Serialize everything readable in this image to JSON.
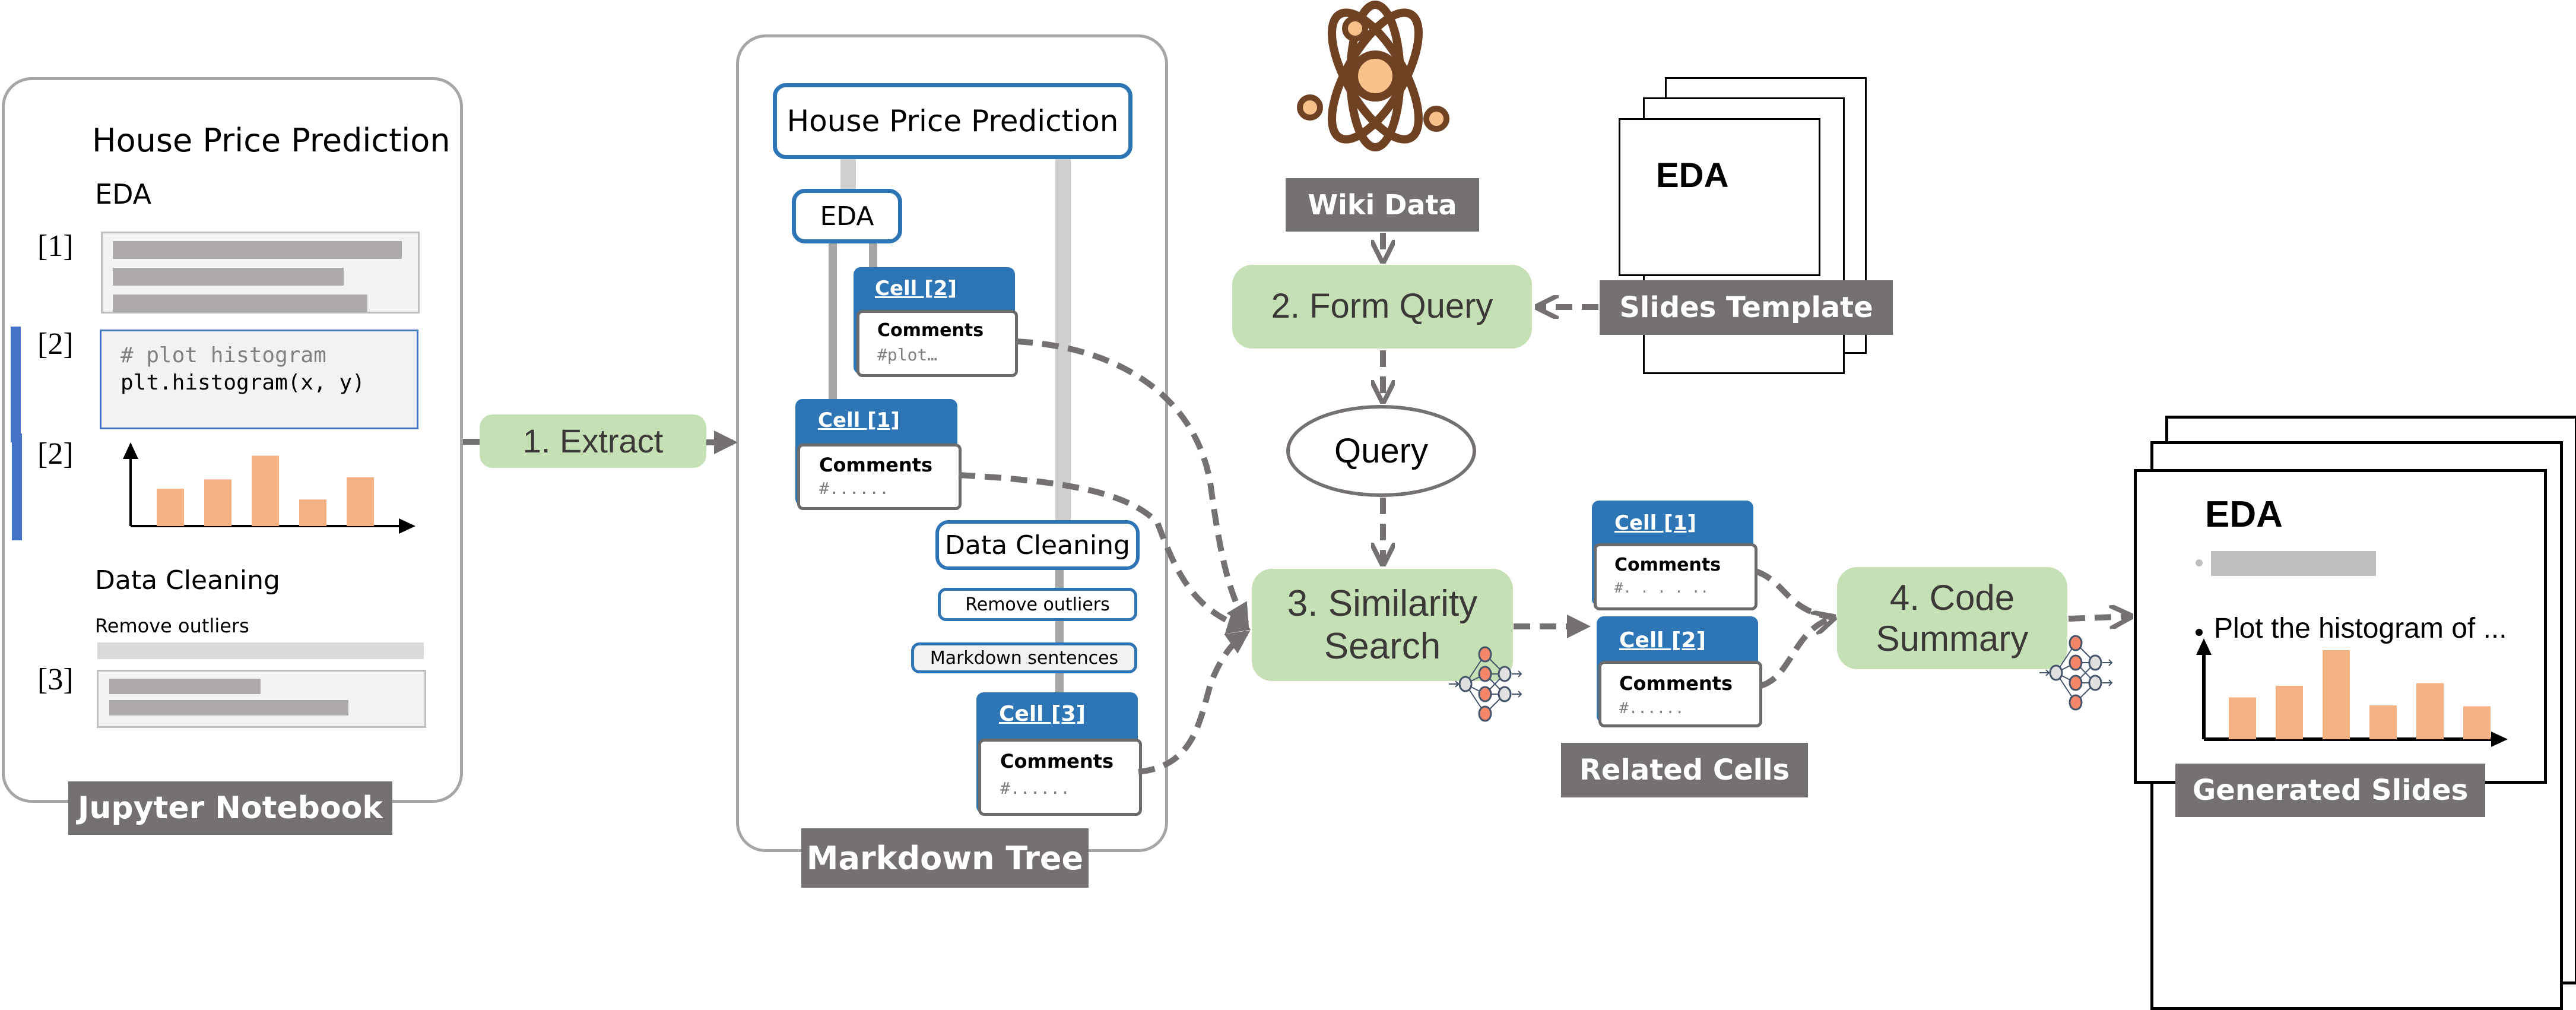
{
  "jupyter_notebook": {
    "label": "Jupyter Notebook",
    "title": "House Price Prediction",
    "section_eda": "EDA",
    "cells": [
      {
        "prompt": "[1]",
        "type": "code-placeholder"
      },
      {
        "prompt": "[2]",
        "type": "code",
        "comment": "# plot histogram",
        "code": "plt.histogram(x, y)"
      },
      {
        "prompt": "[2]",
        "type": "output-histogram",
        "bar_values": [
          0.52,
          0.65,
          0.98,
          0.37,
          0.68
        ]
      }
    ],
    "section_cleaning": "Data Cleaning",
    "subsection": "Remove outliers",
    "cell3_prompt": "[3]"
  },
  "steps": {
    "extract": "1. Extract",
    "form_query": "2. Form Query",
    "similarity_search_line1": "3. Similarity",
    "similarity_search_line2": "Search",
    "code_summary_line1": "4. Code",
    "code_summary_line2": "Summary"
  },
  "markdown_tree": {
    "label": "Markdown Tree",
    "root": "House Price Prediction",
    "eda_node": "EDA",
    "cleaning_node": "Data Cleaning",
    "remove_outliers_node": "Remove outliers",
    "markdown_sentences_node": "Markdown sentences",
    "cells": [
      {
        "title": "Cell [2]",
        "comments": "Comments",
        "snippet": "#plot…"
      },
      {
        "title": "Cell [1]",
        "comments": "Comments",
        "snippet": "#......"
      },
      {
        "title": "Cell [3]",
        "comments": "Comments",
        "snippet": "#......"
      }
    ]
  },
  "wiki": {
    "label": "Wiki Data",
    "icon": "atom-icon"
  },
  "slides_template": {
    "label": "Slides Template",
    "slide_title": "EDA"
  },
  "query": {
    "label": "Query"
  },
  "related_cells": {
    "label": "Related Cells",
    "cells": [
      {
        "title": "Cell [1]",
        "comments": "Comments",
        "snippet": "#. . . . .."
      },
      {
        "title": "Cell [2]",
        "comments": "Comments",
        "snippet": "#......"
      }
    ]
  },
  "generated_slides": {
    "label": "Generated Slides",
    "slide_title": "EDA",
    "bullet_text": "Plot the histogram of ...",
    "bar_values": [
      0.47,
      0.6,
      1.0,
      0.38,
      0.63,
      0.37
    ]
  },
  "colors": {
    "step_green": "#c5e0b4",
    "label_grey": "#767171",
    "node_blue": "#2e75b6",
    "bar_orange": "#f4b183",
    "neuron_orange": "#f4876a"
  }
}
